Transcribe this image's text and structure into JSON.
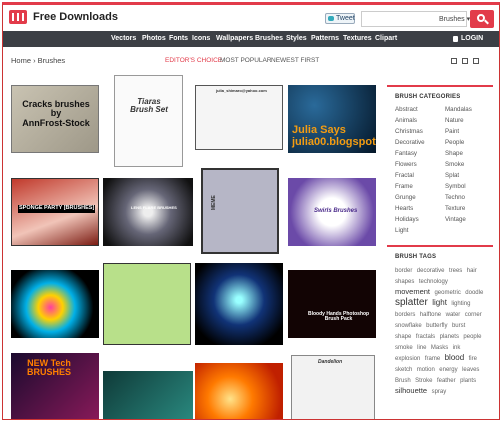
{
  "header": {
    "site_name": "Free Downloads",
    "tweet_label": "Tweet",
    "search_scope": "Brushes ▾",
    "login_label": "LOGIN"
  },
  "nav": {
    "items": [
      "Vectors",
      "Photos",
      "Fonts",
      "Icons",
      "Wallpapers",
      "Brushes",
      "Styles",
      "Patterns",
      "Textures",
      "Clipart"
    ]
  },
  "breadcrumb": "Home › Brushes",
  "tabs": [
    {
      "label": "EDITOR'S CHOICE"
    },
    {
      "label": "MOST POPULAR"
    },
    {
      "label": "NEWEST FIRST"
    }
  ],
  "thumbnails": [
    {
      "text": "Cracks brushes\nby\nAnnFrost-Stock"
    },
    {
      "text": "Tiaras\nBrush Set"
    },
    {
      "text": "julia_shimaro@yahoo.com"
    },
    {
      "text": "Julia Says\njulia00.blogspot.com"
    },
    {
      "text": "SPONGE PARTY [BRUSHES]"
    },
    {
      "text": "LENS FLARE BRUSHES"
    },
    {
      "text": "MEME"
    },
    {
      "text": "Swirls Brushes"
    },
    {
      "text": ""
    },
    {
      "text": ""
    },
    {
      "text": ""
    },
    {
      "text": "Bloody Hands Photoshop\nBrush Pack"
    },
    {
      "text": "NEW Tech\nBRUSHES"
    },
    {
      "text": ""
    },
    {
      "text": ""
    },
    {
      "text": "Dandelion"
    }
  ],
  "categories": {
    "title": "BRUSH CATEGORIES",
    "left": [
      "Abstract",
      "Animals",
      "Christmas",
      "Decorative",
      "Fantasy",
      "Flowers",
      "Fractal",
      "Frame",
      "Grunge",
      "Hearts",
      "Holidays",
      "Light"
    ],
    "right": [
      "Mandalas",
      "Nature",
      "Paint",
      "People",
      "Shape",
      "Smoke",
      "Splat",
      "Symbol",
      "Techno",
      "Texture",
      "Vintage"
    ]
  },
  "tags": {
    "title": "BRUSH TAGS",
    "items": [
      "border",
      "decorative",
      "trees",
      "hair",
      "shapes",
      "technology",
      "movement",
      "geometric",
      "doodle",
      "splatter",
      "light",
      "lighting",
      "borders",
      "halftone",
      "water",
      "corner",
      "snowflake",
      "butterfly",
      "burst",
      "shape",
      "fractals",
      "planets",
      "people",
      "smoke",
      "line",
      "Masks",
      "ink",
      "explosion",
      "frame",
      "blood",
      "fire",
      "sketch",
      "motion",
      "energy",
      "leaves",
      "Brush",
      "Stroke",
      "feather",
      "plants",
      "silhouette",
      "spray"
    ]
  },
  "colors": {
    "accent": "#e23b4a",
    "nav_bg": "#3c3f45"
  }
}
